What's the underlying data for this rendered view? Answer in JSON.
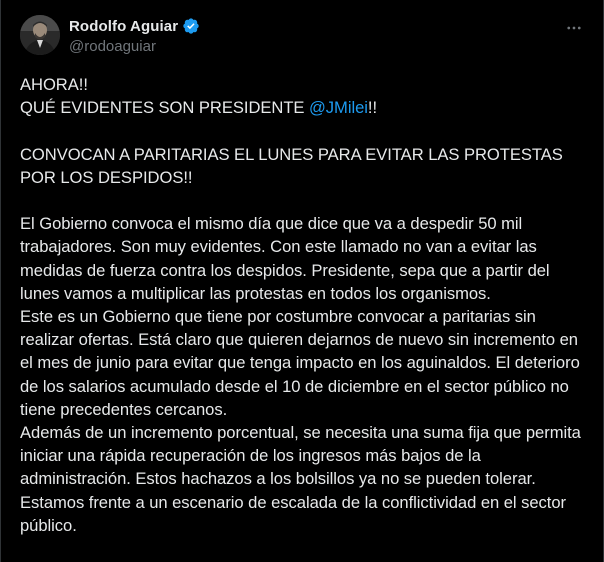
{
  "author": {
    "display_name": "Rodolfo Aguiar",
    "handle": "@rodoaguiar",
    "verified": true
  },
  "header": {
    "more_icon": "more-horizontal-icon"
  },
  "post": {
    "line1": "AHORA!!",
    "line2_prefix": "QUÉ EVIDENTES SON PRESIDENTE ",
    "mention": "@JMilei",
    "line2_suffix": "!!",
    "headline": "CONVOCAN A PARITARIAS EL LUNES PARA EVITAR LAS PROTESTAS POR LOS DESPIDOS!!",
    "paragraph1": "El Gobierno convoca el mismo día que dice que va a despedir 50 mil trabajadores. Son muy evidentes. Con este llamado no van a evitar las medidas de fuerza contra los despidos. Presidente, sepa que a partir del lunes vamos a multiplicar las protestas en todos los organismos.",
    "paragraph2": "Este es un Gobierno que tiene por costumbre convocar a paritarias sin realizar ofertas. Está claro que quieren dejarnos de nuevo sin incremento en el mes de junio para evitar que tenga impacto en los aguinaldos. El deterioro de los salarios acumulado desde el 10 de diciembre en el sector público no tiene precedentes cercanos.",
    "paragraph3": "Además de un incremento porcentual, se necesita una suma fija que permita iniciar una rápida recuperación de los ingresos más bajos de la administración. Estos hachazos a los bolsillos ya no se pueden tolerar. Estamos frente a un escenario de escalada de la conflictividad en el sector público."
  },
  "colors": {
    "background": "#000000",
    "text": "#e7e9ea",
    "secondary_text": "#71767b",
    "link": "#1d9bf0",
    "verified_badge": "#1d9bf0"
  }
}
